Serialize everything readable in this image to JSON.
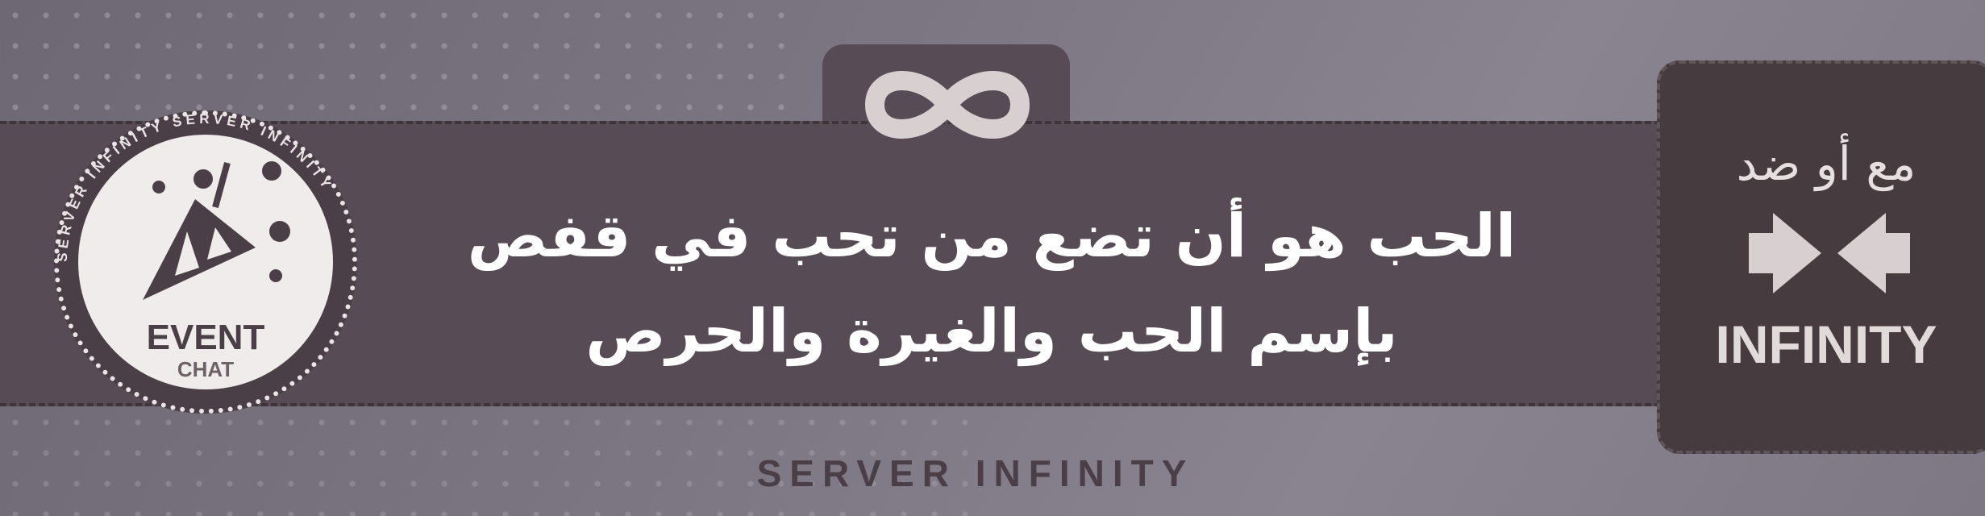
{
  "banner": {
    "quote_line1": "الحب هو أن تضع من تحب في قفص",
    "quote_line2": "بإسم الحب والغيرة والحرص",
    "footer": "SERVER INFINITY"
  },
  "badge": {
    "title": "EVENT",
    "subtitle": "CHAT",
    "ring_text": "SERVER INFINITY SERVER INFINITY"
  },
  "panel": {
    "arabic": "مع أو ضد",
    "brand": "INFINITY"
  },
  "colors": {
    "band": "#574c55",
    "panel": "#463c40",
    "text": "#ffffff"
  }
}
